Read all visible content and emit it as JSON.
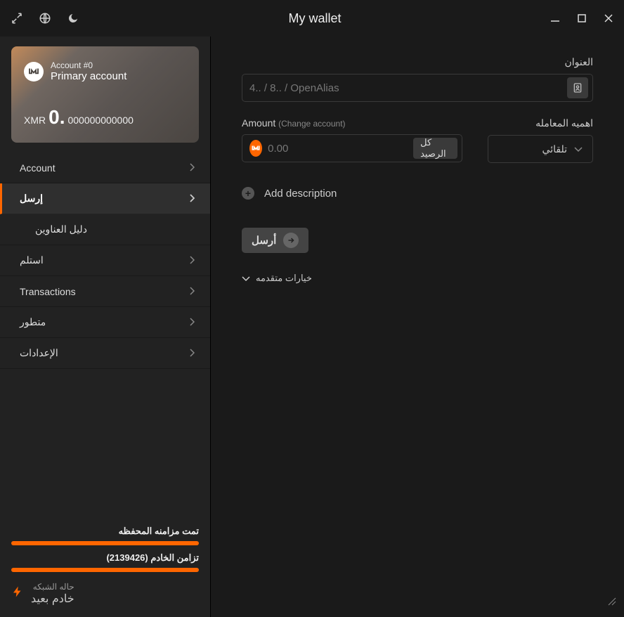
{
  "titlebar": {
    "title": "My wallet"
  },
  "account_card": {
    "subtitle": "Account #0",
    "title": "Primary account",
    "currency": "XMR",
    "balance_int": "0.",
    "balance_dec": "000000000000"
  },
  "nav": {
    "account": "Account",
    "send": "إرسل",
    "address_book": "دليل العناوين",
    "receive": "استلم",
    "transactions": "Transactions",
    "advanced": "متطور",
    "settings": "الإعدادات"
  },
  "status": {
    "wallet_sync_label": "تمت مزامنه المحفظه",
    "daemon_sync_label": "تزامن الخادم (2139426)",
    "network_label": "حاله الشبكه",
    "network_value": "خادم بعيد"
  },
  "form": {
    "address_label": "العنوان",
    "address_placeholder": "4.. / 8.. / OpenAlias",
    "amount_label": "Amount",
    "amount_hint": "(Change account)",
    "amount_placeholder": "0.00",
    "all_button": "كل الرصيد",
    "priority_label": "اهميه المعامله",
    "priority_value": "تلقائي",
    "add_description": "Add description",
    "send_button": "أرسل",
    "advanced_options": "خيارات متقدمه"
  }
}
